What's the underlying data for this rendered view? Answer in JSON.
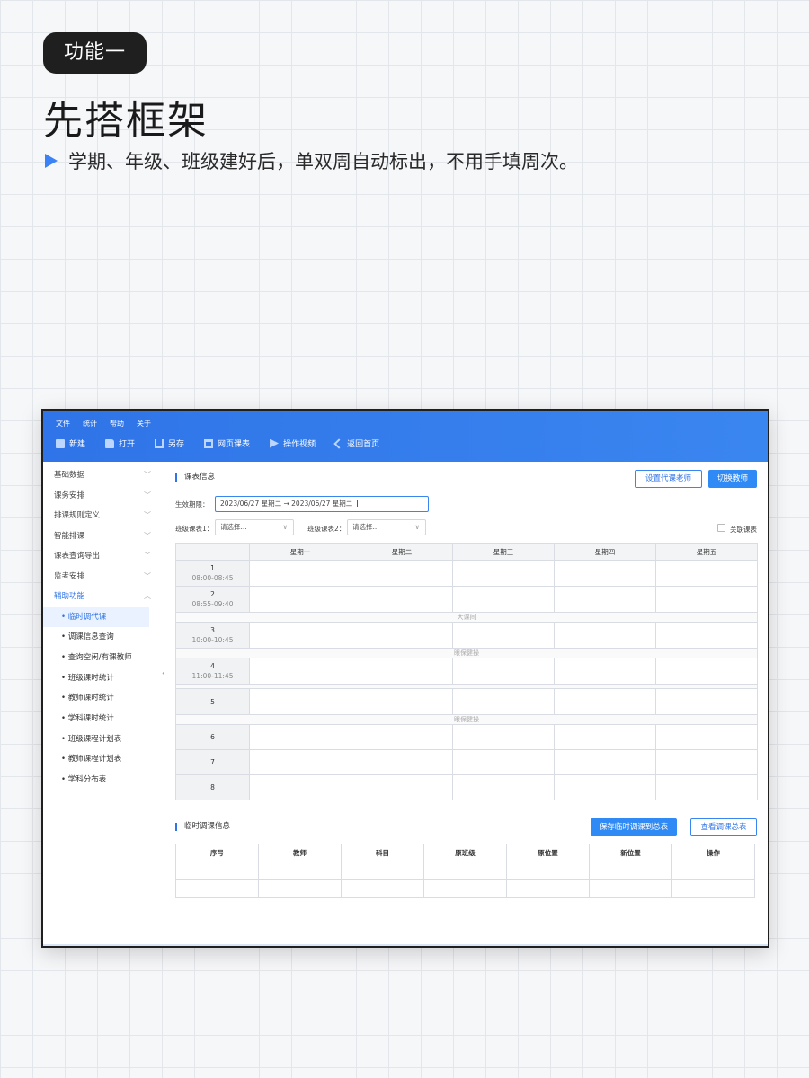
{
  "badge": "功能一",
  "heading": "先搭框架",
  "description": "学期、年级、班级建好后，单双周自动标出，不用手填周次。",
  "app": {
    "menu": [
      "文件",
      "统计",
      "帮助",
      "关于"
    ],
    "toolbar": [
      {
        "label": "新建",
        "icon": "new-file-icon"
      },
      {
        "label": "打开",
        "icon": "open-folder-icon"
      },
      {
        "label": "另存",
        "icon": "save-as-icon"
      },
      {
        "label": "网页课表",
        "icon": "web-timetable-icon"
      },
      {
        "label": "操作视频",
        "icon": "video-icon"
      },
      {
        "label": "返回首页",
        "icon": "back-home-icon"
      }
    ],
    "sidebar": {
      "groups": [
        "基础数据",
        "课务安排",
        "排课规则定义",
        "智能排课",
        "课表查询导出",
        "监考安排",
        "辅助功能"
      ],
      "sub_items": [
        "临时调代课",
        "调课信息查询",
        "查询空闲/有课教师",
        "班级课时统计",
        "教师课时统计",
        "学科课时统计",
        "班级课程计划表",
        "教师课程计划表",
        "学科分布表"
      ]
    },
    "timetable_section": {
      "title": "课表信息",
      "btn_set_teacher": "设置代课老师",
      "btn_switch_teacher": "切换教师",
      "date_label": "生效期限：",
      "date_value": "2023/06/27 星期二 → 2023/06/27 星期二",
      "select1_label": "班级课表1：",
      "select1_placeholder": "请选择...",
      "select2_label": "班级课表2：",
      "select2_placeholder": "请选择...",
      "link_label": "关联课表",
      "days": [
        "星期一",
        "星期二",
        "星期三",
        "星期四",
        "星期五"
      ],
      "periods": [
        {
          "num": "1",
          "time": "08:00-08:45"
        },
        {
          "num": "2",
          "time": "08:55-09:40"
        },
        {
          "num": "3",
          "time": "10:00-10:45"
        },
        {
          "num": "4",
          "time": "11:00-11:45"
        },
        {
          "num": "5",
          "time": ""
        },
        {
          "num": "6",
          "time": ""
        },
        {
          "num": "7",
          "time": ""
        },
        {
          "num": "8",
          "time": ""
        }
      ],
      "break_big": "大课间",
      "break_eye1": "眼保健操",
      "break_eye2": "眼保健操"
    },
    "adjust_section": {
      "title": "临时调课信息",
      "btn_save": "保存临时调课到总表",
      "btn_view": "查看调课总表",
      "columns": [
        "序号",
        "教师",
        "科目",
        "原班级",
        "原位置",
        "新位置",
        "操作"
      ]
    }
  },
  "colors": {
    "accent": "#2f74e8",
    "badge_bg": "#1f1f1f",
    "arrow": "#3b82f6"
  }
}
